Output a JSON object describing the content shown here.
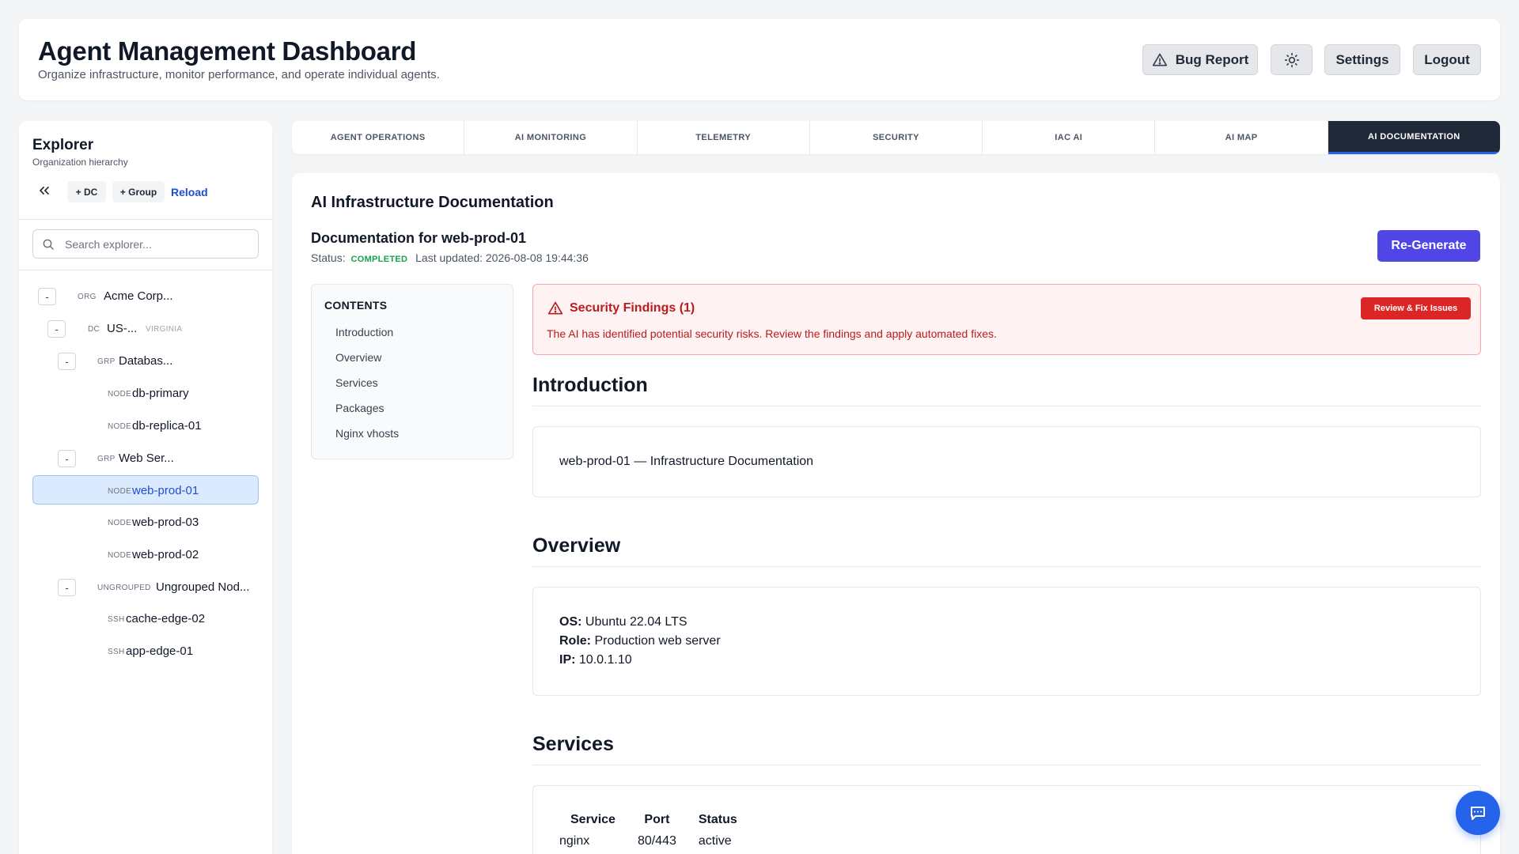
{
  "header": {
    "title": "Agent Management Dashboard",
    "subtitle": "Organize infrastructure, monitor performance, and operate individual agents.",
    "bug_report": "Bug Report",
    "settings": "Settings",
    "logout": "Logout"
  },
  "sidebar": {
    "title": "Explorer",
    "subtitle": "Organization hierarchy",
    "add_dc": "+ DC",
    "add_group": "+ Group",
    "reload": "Reload",
    "search_placeholder": "Search explorer...",
    "tree": [
      {
        "toggle": "-",
        "type": "ORG",
        "name": "Acme Corp..."
      },
      {
        "toggle": "-",
        "type": "DC",
        "name": "US-...",
        "meta": "VIRGINIA"
      },
      {
        "toggle": "-",
        "type": "GRP",
        "name": "Databas..."
      },
      {
        "type": "NODE",
        "name": "db-primary"
      },
      {
        "type": "NODE",
        "name": "db-replica-01"
      },
      {
        "toggle": "-",
        "type": "GRP",
        "name": "Web Ser..."
      },
      {
        "type": "NODE",
        "name": "web-prod-01",
        "selected": true
      },
      {
        "type": "NODE",
        "name": "web-prod-03"
      },
      {
        "type": "NODE",
        "name": "web-prod-02"
      },
      {
        "toggle": "-",
        "type": "UNGROUPED",
        "name": "Ungrouped Nod..."
      },
      {
        "type": "SSH",
        "name": "cache-edge-02"
      },
      {
        "type": "SSH",
        "name": "app-edge-01"
      }
    ]
  },
  "tabs": [
    {
      "label": "AGENT OPERATIONS"
    },
    {
      "label": "AI MONITORING"
    },
    {
      "label": "TELEMETRY"
    },
    {
      "label": "SECURITY"
    },
    {
      "label": "IAC AI"
    },
    {
      "label": "AI MAP"
    },
    {
      "label": "AI DOCUMENTATION",
      "active": true
    }
  ],
  "main": {
    "title": "AI Infrastructure Documentation",
    "doc_title": "Documentation for web-prod-01",
    "status_label": "Status:",
    "status_value": "COMPLETED",
    "last_updated": "Last updated: 2026-08-08 19:44:36",
    "regenerate": "Re-Generate",
    "toc": {
      "title": "CONTENTS",
      "items": [
        "Introduction",
        "Overview",
        "Services",
        "Packages",
        "Nginx vhosts"
      ]
    },
    "alert": {
      "title": "Security Findings (1)",
      "text": "The AI has identified potential security risks. Review the findings and apply automated fixes.",
      "button": "Review & Fix Issues"
    },
    "introduction": {
      "heading": "Introduction",
      "text": "web-prod-01 — Infrastructure Documentation"
    },
    "overview": {
      "heading": "Overview",
      "os_label": "OS:",
      "os_value": "Ubuntu 22.04 LTS",
      "role_label": "Role:",
      "role_value": "Production web server",
      "ip_label": "IP:",
      "ip_value": "10.0.1.10"
    },
    "services": {
      "heading": "Services",
      "columns": [
        "Service",
        "Port",
        "Status"
      ],
      "rows": [
        [
          "nginx",
          "80/443",
          "active"
        ]
      ]
    }
  },
  "colors": {
    "accent": "#4f46e5",
    "active_tab": "#1f2937",
    "status_completed": "#16a34a",
    "alert_red": "#dc2626",
    "link_blue": "#1d4ed8"
  },
  "icons": {
    "bug_report": "warning-triangle-icon",
    "theme": "sun-icon",
    "collapse": "double-chevron-left-icon",
    "search": "search-icon",
    "alert": "warning-triangle-icon",
    "chat": "chat-icon"
  }
}
